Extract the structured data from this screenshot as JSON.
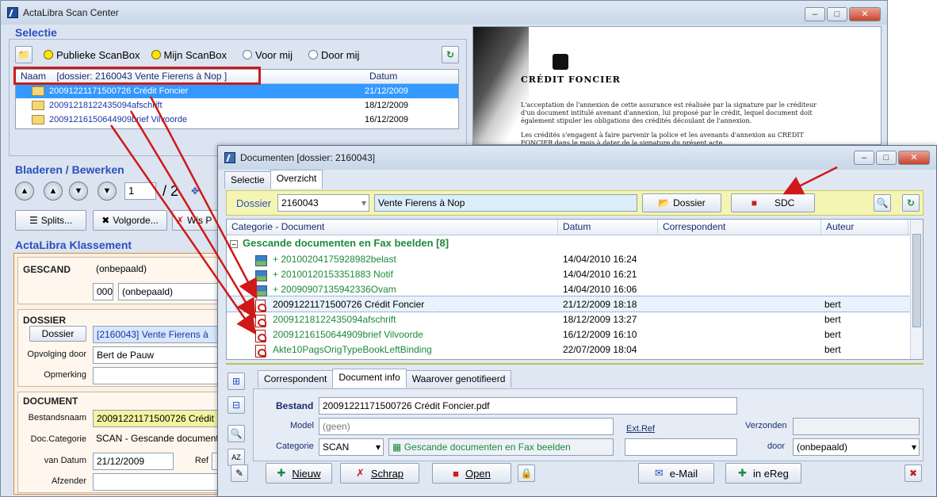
{
  "back_window": {
    "title": "ActaLibra Scan Center",
    "win_controls": [
      "–",
      "□",
      "✕"
    ],
    "selectie_title": "Selectie",
    "radios": [
      "Publieke ScanBox",
      "Mijn ScanBox",
      "Voor mij",
      "Door mij"
    ],
    "list": {
      "col_naam": "Naam",
      "col_dossier": "[dossier:  2160043 Vente Fierens à Nop ]",
      "col_datum": "Datum",
      "rows": [
        {
          "name": "20091221171500726 Crédit Foncier",
          "date": "21/12/2009"
        },
        {
          "name": "20091218122435094afschrift",
          "date": "18/12/2009"
        },
        {
          "name": "20091216150644909brief Vilvoorde",
          "date": "16/12/2009"
        }
      ]
    },
    "bladeren_title": "Bladeren / Bewerken",
    "page_current": "1",
    "page_total": "/ 2",
    "btn_splits": "Splits...",
    "btn_volgorde": "Volgorde...",
    "btn_wis": "Wis P",
    "klassement_title": "ActaLibra Klassement",
    "gescand": {
      "head": "GESCAND",
      "value1": "(onbepaald)",
      "code": "000",
      "value2": "(onbepaald)"
    },
    "dossier": {
      "head": "DOSSIER",
      "btn": "Dossier",
      "value": "[2160043] Vente Fierens à",
      "label_opvolging": "Opvolging door",
      "opvolging": "Bert de Pauw",
      "label_opmerking": "Opmerking",
      "opmerking": ""
    },
    "document": {
      "head": "DOCUMENT",
      "label_bestandsnaam": "Bestandsnaam",
      "bestandsnaam": "20091221171500726 Crédit",
      "label_doccat": "Doc.Categorie",
      "doccat": "SCAN - Gescande document",
      "label_vandatum": "van Datum",
      "vandatum": "21/12/2009",
      "label_ref": "Ref",
      "label_afzender": "Afzender"
    },
    "preview": {
      "brand": "CRÉDIT FONCIER",
      "para1": "L'acceptation de l'annexion de cette assurance est réalisée par la signature par le créditeur d'un document intitulé avenant d'annexion, lui proposé par le crédit, lequel document doit également stipuler les obligations des crédités découlant de l'annexion.",
      "para2": "Les crédités s'engagent à faire parvenir la police et les avenants d'annexion au CREDIT FONCIER dans le mois à dater de la signature du présent acte."
    }
  },
  "front_window": {
    "title": "Documenten  [dossier: 2160043]",
    "tabs": [
      "Selectie",
      "Overzicht"
    ],
    "dossier_label": "Dossier",
    "dossier_code": "2160043",
    "dossier_name": "Vente Fierens à Nop",
    "btn_dossier": "Dossier",
    "btn_sdc": "SDC",
    "table": {
      "headers": [
        "Categorie - Document",
        "Datum",
        "Correspondent",
        "Auteur"
      ],
      "group": "Gescande documenten en Fax beelden [8]",
      "rows": [
        {
          "name": "+ 20100204175928982belast",
          "date": "14/04/2010 16:24",
          "corr": "",
          "author": "",
          "icon": "image"
        },
        {
          "name": "+ 20100120153351883 Notif",
          "date": "14/04/2010 16:21",
          "corr": "",
          "author": "",
          "icon": "image"
        },
        {
          "name": "+ 20090907135942336Ovam",
          "date": "14/04/2010 16:06",
          "corr": "",
          "author": "",
          "icon": "image"
        },
        {
          "name": "20091221171500726 Crédit Foncier",
          "date": "21/12/2009 18:18",
          "corr": "",
          "author": "bert",
          "icon": "pdf"
        },
        {
          "name": "20091218122435094afschrift",
          "date": "18/12/2009 13:27",
          "corr": "",
          "author": "bert",
          "icon": "pdf"
        },
        {
          "name": "20091216150644909brief Vilvoorde",
          "date": "16/12/2009 16:10",
          "corr": "",
          "author": "bert",
          "icon": "pdf"
        },
        {
          "name": "Akte10PagsOrigTypeBookLeftBinding",
          "date": "22/07/2009 18:04",
          "corr": "",
          "author": "bert",
          "icon": "pdf"
        }
      ]
    },
    "detail_tabs": [
      "Correspondent",
      "Document info",
      "Waarover genotifieerd"
    ],
    "detail": {
      "label_bestand": "Bestand",
      "bestand": "20091221171500726 Crédit Foncier.pdf",
      "label_model": "Model",
      "model": "(geen)",
      "label_extref": "Ext.Ref",
      "label_verzonden": "Verzonden",
      "label_categorie": "Categorie",
      "categorie": "SCAN",
      "categorie_desc": "Gescande documenten en Fax beelden",
      "label_door": "door",
      "door": "(onbepaald)"
    },
    "buttons": {
      "nieuw": "Nieuw",
      "schrap": "Schrap",
      "open": "Open",
      "email": "e-Mail",
      "ereg": "in eReg"
    }
  }
}
